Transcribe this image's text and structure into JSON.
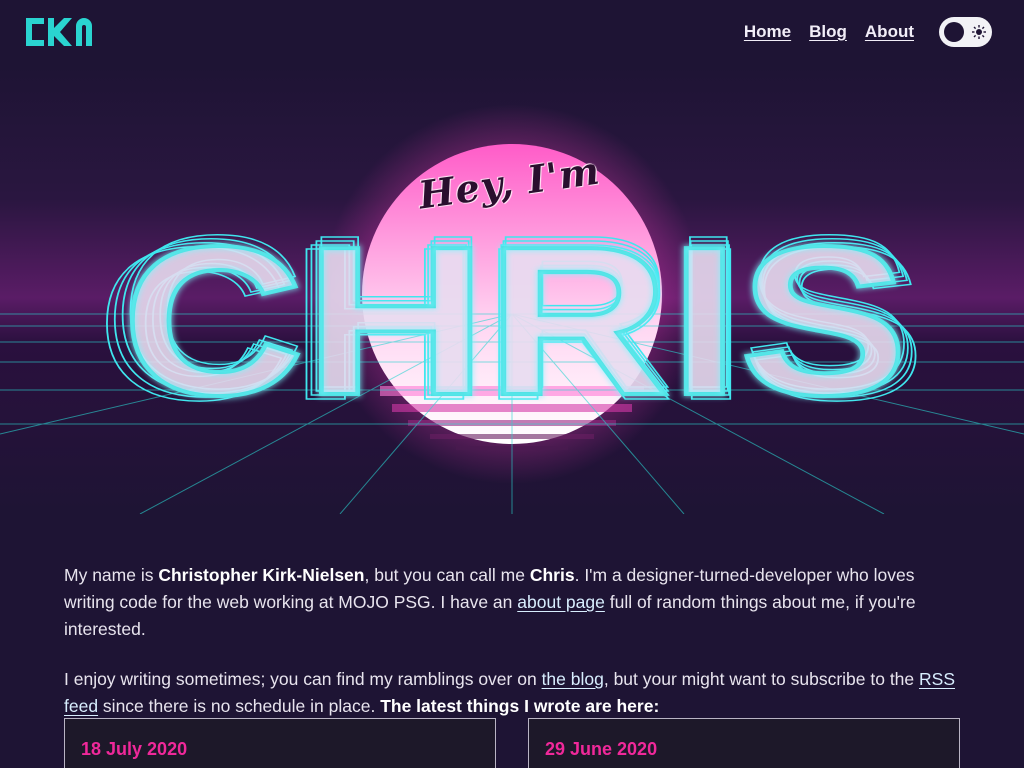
{
  "header": {
    "logo_text": "CKN",
    "nav": [
      {
        "label": "Home"
      },
      {
        "label": "Blog"
      },
      {
        "label": "About"
      }
    ],
    "theme_toggle": {
      "state": "dark",
      "icons": [
        "moon-icon",
        "sun-icon"
      ]
    }
  },
  "hero": {
    "greeting": "Hey, I'm",
    "name": "CHRIS"
  },
  "intro": {
    "p1": {
      "t1": "My name is ",
      "b1": "Christopher Kirk-Nielsen",
      "t2": ", but you can call me ",
      "b2": "Chris",
      "t3": ". I'm a designer-turned-developer who loves writing code for the web working at MOJO PSG. I have an ",
      "link": "about page",
      "t4": " full of random things about me, if you're interested."
    },
    "p2": {
      "t1": "I enjoy writing sometimes; you can find my ramblings over on ",
      "link1": "the blog",
      "t2": ", but your might want to subscribe to the ",
      "link2": "RSS feed",
      "t3": " since there is no schedule in place. ",
      "b1": "The latest things I wrote are here:"
    }
  },
  "posts": [
    {
      "date": "18 July 2020"
    },
    {
      "date": "29 June 2020"
    }
  ],
  "colors": {
    "background": "#1e1434",
    "accent_cyan": "#2ad4d0",
    "accent_pink": "#f0289a",
    "sun": "#ff3fbf"
  }
}
